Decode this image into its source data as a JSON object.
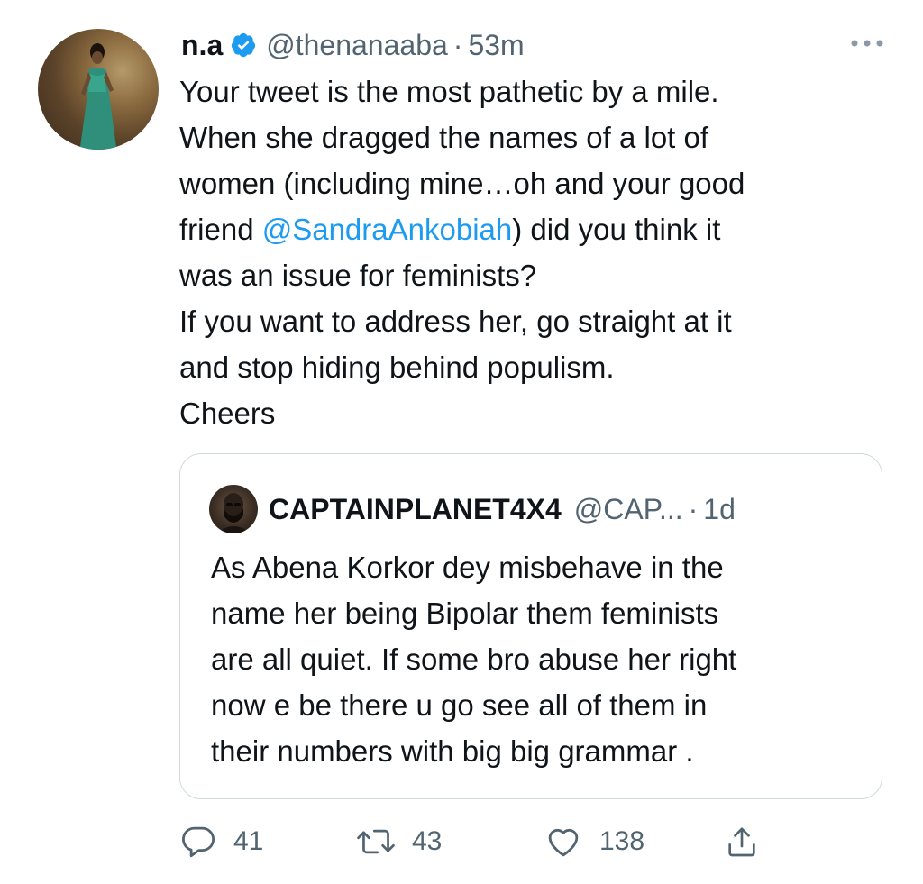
{
  "tweet": {
    "author": {
      "display_name": "n.a",
      "handle": "@thenanaaba",
      "verified": true
    },
    "separator": "·",
    "time": "53m",
    "more_icon": "ellipsis-icon",
    "text": {
      "line1": "Your tweet is the most pathetic by a mile.",
      "line2": "When she dragged the names of a lot of",
      "line3": "women (including mine…oh and your good",
      "line4_before": "friend ",
      "mention": "@SandraAnkobiah",
      "line4_after": ") did you think it",
      "line5": "was an issue for feminists?",
      "line6": "If you want to address her, go straight at it",
      "line7": "and stop hiding behind populism.",
      "line8": "Cheers"
    },
    "quoted": {
      "display_name": "CAPTAINPLANET4X4",
      "handle": "@CAP...",
      "separator": "·",
      "time": "1d",
      "text": {
        "line1": "As Abena Korkor dey misbehave in the",
        "line2": "name her being Bipolar them feminists",
        "line3": "are all quiet. If some bro abuse her right",
        "line4": "now e be there u go see all of them in",
        "line5": "their numbers with big big grammar ."
      }
    },
    "actions": {
      "reply": {
        "icon": "reply-icon",
        "count": "41"
      },
      "retweet": {
        "icon": "retweet-icon",
        "count": "43"
      },
      "like": {
        "icon": "heart-icon",
        "count": "138"
      },
      "share": {
        "icon": "share-icon"
      }
    }
  },
  "colors": {
    "text": "#0f1419",
    "secondary": "#536471",
    "link": "#1d9bf0",
    "verified": "#1d9bf0",
    "border": "#cfd9de"
  }
}
